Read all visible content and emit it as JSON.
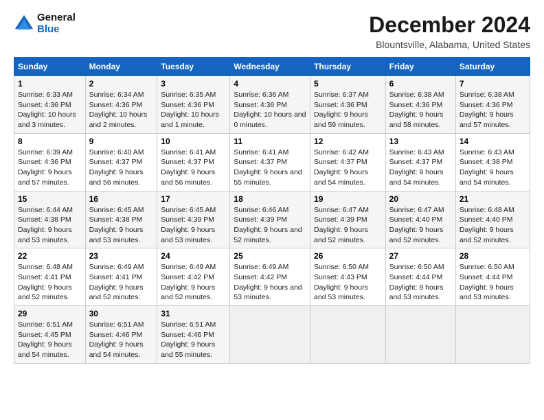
{
  "logo": {
    "line1": "General",
    "line2": "Blue"
  },
  "title": "December 2024",
  "location": "Blountsville, Alabama, United States",
  "weekdays": [
    "Sunday",
    "Monday",
    "Tuesday",
    "Wednesday",
    "Thursday",
    "Friday",
    "Saturday"
  ],
  "weeks": [
    [
      {
        "day": "1",
        "sunrise": "6:33 AM",
        "sunset": "4:36 PM",
        "daylight": "10 hours and 3 minutes."
      },
      {
        "day": "2",
        "sunrise": "6:34 AM",
        "sunset": "4:36 PM",
        "daylight": "10 hours and 2 minutes."
      },
      {
        "day": "3",
        "sunrise": "6:35 AM",
        "sunset": "4:36 PM",
        "daylight": "10 hours and 1 minute."
      },
      {
        "day": "4",
        "sunrise": "6:36 AM",
        "sunset": "4:36 PM",
        "daylight": "10 hours and 0 minutes."
      },
      {
        "day": "5",
        "sunrise": "6:37 AM",
        "sunset": "4:36 PM",
        "daylight": "9 hours and 59 minutes."
      },
      {
        "day": "6",
        "sunrise": "6:38 AM",
        "sunset": "4:36 PM",
        "daylight": "9 hours and 58 minutes."
      },
      {
        "day": "7",
        "sunrise": "6:38 AM",
        "sunset": "4:36 PM",
        "daylight": "9 hours and 57 minutes."
      }
    ],
    [
      {
        "day": "8",
        "sunrise": "6:39 AM",
        "sunset": "4:36 PM",
        "daylight": "9 hours and 57 minutes."
      },
      {
        "day": "9",
        "sunrise": "6:40 AM",
        "sunset": "4:37 PM",
        "daylight": "9 hours and 56 minutes."
      },
      {
        "day": "10",
        "sunrise": "6:41 AM",
        "sunset": "4:37 PM",
        "daylight": "9 hours and 56 minutes."
      },
      {
        "day": "11",
        "sunrise": "6:41 AM",
        "sunset": "4:37 PM",
        "daylight": "9 hours and 55 minutes."
      },
      {
        "day": "12",
        "sunrise": "6:42 AM",
        "sunset": "4:37 PM",
        "daylight": "9 hours and 54 minutes."
      },
      {
        "day": "13",
        "sunrise": "6:43 AM",
        "sunset": "4:37 PM",
        "daylight": "9 hours and 54 minutes."
      },
      {
        "day": "14",
        "sunrise": "6:43 AM",
        "sunset": "4:38 PM",
        "daylight": "9 hours and 54 minutes."
      }
    ],
    [
      {
        "day": "15",
        "sunrise": "6:44 AM",
        "sunset": "4:38 PM",
        "daylight": "9 hours and 53 minutes."
      },
      {
        "day": "16",
        "sunrise": "6:45 AM",
        "sunset": "4:38 PM",
        "daylight": "9 hours and 53 minutes."
      },
      {
        "day": "17",
        "sunrise": "6:45 AM",
        "sunset": "4:39 PM",
        "daylight": "9 hours and 53 minutes."
      },
      {
        "day": "18",
        "sunrise": "6:46 AM",
        "sunset": "4:39 PM",
        "daylight": "9 hours and 52 minutes."
      },
      {
        "day": "19",
        "sunrise": "6:47 AM",
        "sunset": "4:39 PM",
        "daylight": "9 hours and 52 minutes."
      },
      {
        "day": "20",
        "sunrise": "6:47 AM",
        "sunset": "4:40 PM",
        "daylight": "9 hours and 52 minutes."
      },
      {
        "day": "21",
        "sunrise": "6:48 AM",
        "sunset": "4:40 PM",
        "daylight": "9 hours and 52 minutes."
      }
    ],
    [
      {
        "day": "22",
        "sunrise": "6:48 AM",
        "sunset": "4:41 PM",
        "daylight": "9 hours and 52 minutes."
      },
      {
        "day": "23",
        "sunrise": "6:49 AM",
        "sunset": "4:41 PM",
        "daylight": "9 hours and 52 minutes."
      },
      {
        "day": "24",
        "sunrise": "6:49 AM",
        "sunset": "4:42 PM",
        "daylight": "9 hours and 52 minutes."
      },
      {
        "day": "25",
        "sunrise": "6:49 AM",
        "sunset": "4:42 PM",
        "daylight": "9 hours and 53 minutes."
      },
      {
        "day": "26",
        "sunrise": "6:50 AM",
        "sunset": "4:43 PM",
        "daylight": "9 hours and 53 minutes."
      },
      {
        "day": "27",
        "sunrise": "6:50 AM",
        "sunset": "4:44 PM",
        "daylight": "9 hours and 53 minutes."
      },
      {
        "day": "28",
        "sunrise": "6:50 AM",
        "sunset": "4:44 PM",
        "daylight": "9 hours and 53 minutes."
      }
    ],
    [
      {
        "day": "29",
        "sunrise": "6:51 AM",
        "sunset": "4:45 PM",
        "daylight": "9 hours and 54 minutes."
      },
      {
        "day": "30",
        "sunrise": "6:51 AM",
        "sunset": "4:46 PM",
        "daylight": "9 hours and 54 minutes."
      },
      {
        "day": "31",
        "sunrise": "6:51 AM",
        "sunset": "4:46 PM",
        "daylight": "9 hours and 55 minutes."
      },
      null,
      null,
      null,
      null
    ]
  ]
}
